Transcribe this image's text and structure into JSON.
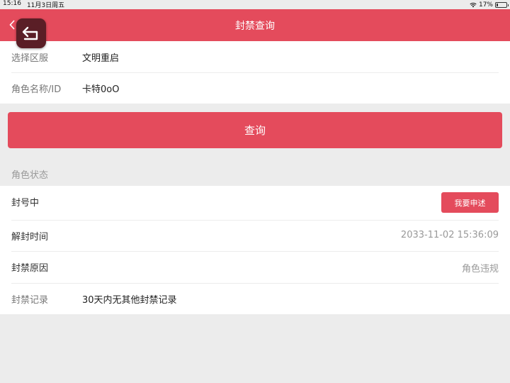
{
  "status_bar": {
    "time": "15:16",
    "date": "11月3日周五",
    "battery_text": "17%",
    "battery_level": 0.17
  },
  "nav": {
    "title": "封禁查询",
    "back_icon": "chevron-left-icon",
    "floating_icon": "return-arrow-icon"
  },
  "form": {
    "server_label": "选择区服",
    "server_value": "文明重启",
    "role_label": "角色名称/ID",
    "role_value": "卡特0oO"
  },
  "query_button": "查询",
  "role_status": {
    "section_title": "角色状态",
    "status_text": "封号中",
    "appeal_button": "我要申述",
    "unban_label": "解封时间",
    "unban_value": "2033-11-02 15:36:09",
    "reason_label": "封禁原因",
    "reason_value": "角色违规",
    "record_label": "封禁记录",
    "record_value": "30天内无其他封禁记录"
  },
  "colors": {
    "accent": "#e44b5c",
    "background": "#ececec"
  }
}
